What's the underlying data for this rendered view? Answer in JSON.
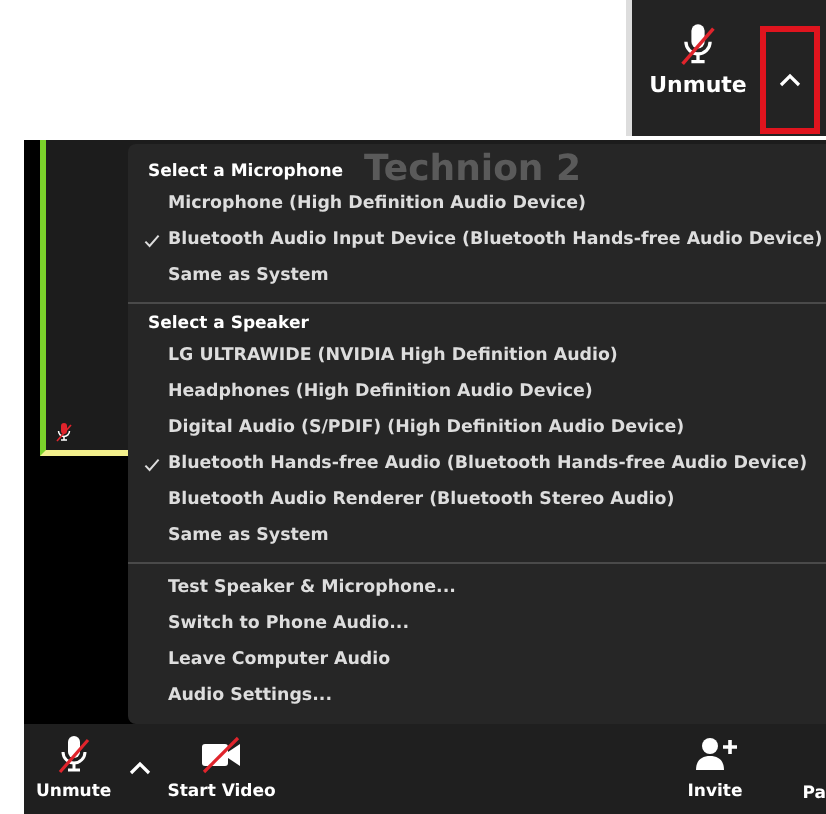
{
  "inset": {
    "label": "Unmute",
    "muted": true,
    "highlighted": true
  },
  "tile": {
    "name": "Technion 2",
    "muted": true
  },
  "menu": {
    "sections": [
      {
        "header": "Select a Microphone",
        "items": [
          {
            "label": "Microphone (High Definition Audio Device)",
            "selected": false
          },
          {
            "label": "Bluetooth Audio Input Device (Bluetooth Hands-free Audio Device)",
            "selected": true
          },
          {
            "label": "Same as System",
            "selected": false
          }
        ]
      },
      {
        "header": "Select a Speaker",
        "items": [
          {
            "label": "LG ULTRAWIDE (NVIDIA High Definition Audio)",
            "selected": false
          },
          {
            "label": "Headphones (High Definition Audio Device)",
            "selected": false
          },
          {
            "label": "Digital Audio (S/PDIF) (High Definition Audio Device)",
            "selected": false
          },
          {
            "label": "Bluetooth Hands-free Audio (Bluetooth Hands-free Audio Device)",
            "selected": true
          },
          {
            "label": "Bluetooth Audio Renderer (Bluetooth Stereo Audio)",
            "selected": false
          },
          {
            "label": "Same as System",
            "selected": false
          }
        ]
      },
      {
        "items": [
          {
            "label": "Test Speaker & Microphone..."
          },
          {
            "label": "Switch to Phone Audio..."
          },
          {
            "label": "Leave Computer Audio"
          },
          {
            "label": "Audio Settings..."
          }
        ]
      }
    ]
  },
  "toolbar": {
    "items": [
      {
        "kind": "mic",
        "label": "Unmute",
        "muted": true
      },
      {
        "kind": "caret"
      },
      {
        "kind": "video",
        "label": "Start Video",
        "muted": true
      },
      {
        "kind": "spacer"
      },
      {
        "kind": "invite",
        "label": "Invite"
      },
      {
        "kind": "text",
        "label": "Pa"
      }
    ]
  }
}
